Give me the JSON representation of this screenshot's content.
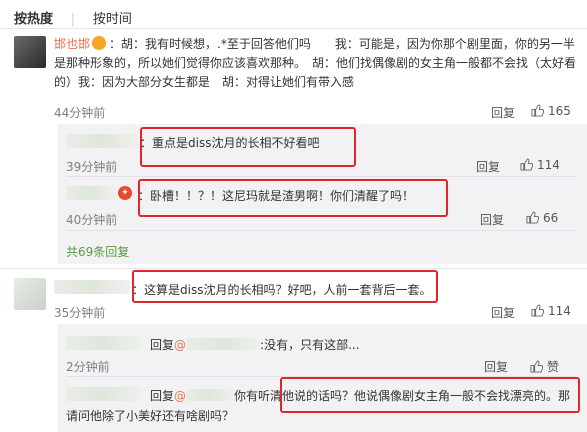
{
  "sort_tabs": {
    "hot": "按热度",
    "time": "按时间"
  },
  "comment1": {
    "username": "邯也邯",
    "text": "：胡：我有时候想，.*至于回答他们吗　　我：可能是，因为你那个剧里面，你的另一半是那种形象的，所以她们觉得你应该喜欢那种。　胡：他们找偶像剧的女主角一般都不会找（太好看的）我：因为大部分女生都是　胡：对得让她们有带入感",
    "time": "44分钟前",
    "reply": "回复",
    "likes": "165"
  },
  "replies": [
    {
      "text": "重点是diss沈月的长相不好看吧",
      "time": "39分钟前",
      "reply": "回复",
      "likes": "114"
    },
    {
      "text": "卧槽！！？！这尼玛就是渣男啊！你们清醒了吗！",
      "time": "40分钟前",
      "reply": "回复",
      "likes": "66"
    }
  ],
  "total_replies": "共69条回复",
  "comment2": {
    "text": "这算是diss沈月的长相吗？好吧，人前一套背后一套。",
    "time": "35分钟前",
    "reply": "回复",
    "likes": "114"
  },
  "replies2": [
    {
      "reply_prefix": "回复",
      "mention": "@",
      "text": "没有，只有这部...",
      "time": "2分钟前",
      "reply": "回复",
      "likes": "赞"
    },
    {
      "reply_prefix": "回复",
      "mention": "@",
      "text_a": "你有听清他说的话吗？他说偶像剧女主角一般不会找漂亮的。那",
      "text_b": "请问他除了小美好还有啥剧吗？"
    }
  ]
}
